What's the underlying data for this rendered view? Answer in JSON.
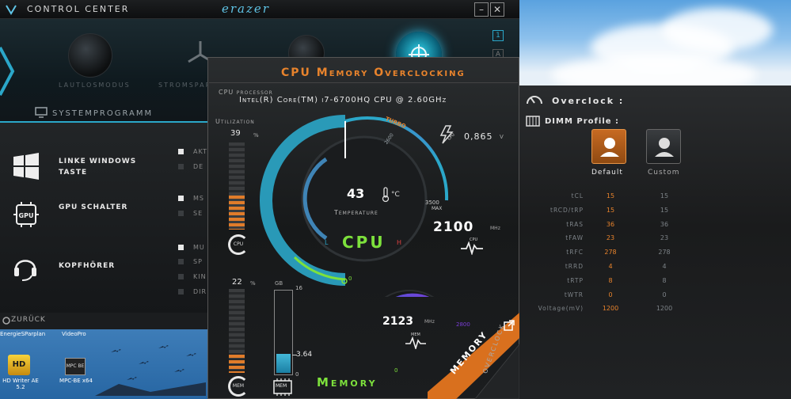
{
  "control_center": {
    "title": "CONTROL CENTER",
    "logo": "erazer",
    "win_minimize": "–",
    "win_close": "✕",
    "side_buttons": [
      "1",
      "A"
    ],
    "modes": [
      "LAUTLOSMODUS",
      "STROMSPAR"
    ],
    "systemprogramm": "SYSTEMPROGRAMM",
    "rows": [
      {
        "label_line1": "LINKE WINDOWS",
        "label_line2": "TASTE",
        "icon": "windows-icon",
        "options": [
          "AKT",
          "DE"
        ],
        "checked": [
          true,
          false
        ]
      },
      {
        "label_line1": "GPU SCHALTER",
        "label_line2": "",
        "icon": "gpu-icon",
        "options": [
          "MS",
          "SE"
        ],
        "checked": [
          true,
          false
        ]
      },
      {
        "label_line1": "KOPFHÖRER",
        "label_line2": "",
        "icon": "headphones-icon",
        "options": [
          "MU",
          "SP",
          "KIN",
          "DIR"
        ],
        "checked": [
          true,
          false,
          false,
          false
        ]
      }
    ],
    "back": "ZURÜCK"
  },
  "desktop": {
    "labels": [
      "EnergieSParplan",
      "VideoPro"
    ],
    "icons": [
      {
        "label": "HD Writer AE 5.2",
        "badge": "HD"
      },
      {
        "label": "MPC-BE x64",
        "badge": "MPC BE"
      }
    ]
  },
  "oc_window": {
    "title": "CPU Memory Overclocking",
    "cpu_processor_label": "CPU processor",
    "cpu_processor_name": "Intel(R) Core(TM) i7-6700HQ CPU @ 2.60GHz",
    "cpu_util_label": "Utilization",
    "cpu_util_value": "39",
    "cpu_util_unit": "%",
    "cpu_util_fraction": 0.39,
    "cpu_icon_label": "CPU",
    "voltage": "0,865",
    "voltage_unit": "V",
    "voltage_icon_label": "CPU",
    "gauge_turbo_label": "TURBO",
    "gauge_tick_2600": "2600",
    "gauge_max_value": "3500",
    "gauge_max_label": "MAX",
    "gauge_zero": "0",
    "gauge_l": "L",
    "gauge_h": "H",
    "temperature": "43",
    "temperature_unit": "°C",
    "temperature_label": "Temperature",
    "cpu_big_label": "CPU",
    "cpu_freq": "2100",
    "cpu_freq_unit": "MHz",
    "cpu_freq_icon_label": "CPU",
    "mem_util_value": "22",
    "mem_util_unit": "%",
    "mem_util_fraction": 0.22,
    "mem_icon_label": "MEM",
    "mem_gb_label": "GB",
    "mem_total": "16",
    "mem_zero": "0",
    "mem_current": "3.64",
    "mem_fraction": 0.2275,
    "mem_chip_label": "MEM",
    "mem_freq": "2123",
    "mem_freq_unit": "MHz",
    "mem_freq_icon_label": "MEM",
    "mem_gauge_zero": "0",
    "mem_gauge_max": "2800",
    "mem_big_label": "Memory",
    "tab_memory": "MEMORY",
    "tab_overclock": "OVERCLOCK"
  },
  "overclock_panel": {
    "title": "Overclock :",
    "dimm_profile": "DIMM Profile :",
    "profiles": [
      "Default",
      "Custom"
    ],
    "rows": [
      {
        "name": "tCL",
        "default": "15",
        "custom": "15"
      },
      {
        "name": "tRCD/tRP",
        "default": "15",
        "custom": "15"
      },
      {
        "name": "tRAS",
        "default": "36",
        "custom": "36"
      },
      {
        "name": "tFAW",
        "default": "23",
        "custom": "23"
      },
      {
        "name": "tRFC",
        "default": "278",
        "custom": "278"
      },
      {
        "name": "tRRD",
        "default": "4",
        "custom": "4"
      },
      {
        "name": "tRTP",
        "default": "8",
        "custom": "8"
      },
      {
        "name": "tWTR",
        "default": "0",
        "custom": "0"
      },
      {
        "name": "Voltage(mV)",
        "default": "1200",
        "custom": "1200"
      }
    ]
  },
  "colors": {
    "accent_orange": "#e8832c",
    "accent_cyan": "#2ba7c9",
    "accent_green": "#7de13c",
    "gauge_purple": "#7a3cd6"
  }
}
